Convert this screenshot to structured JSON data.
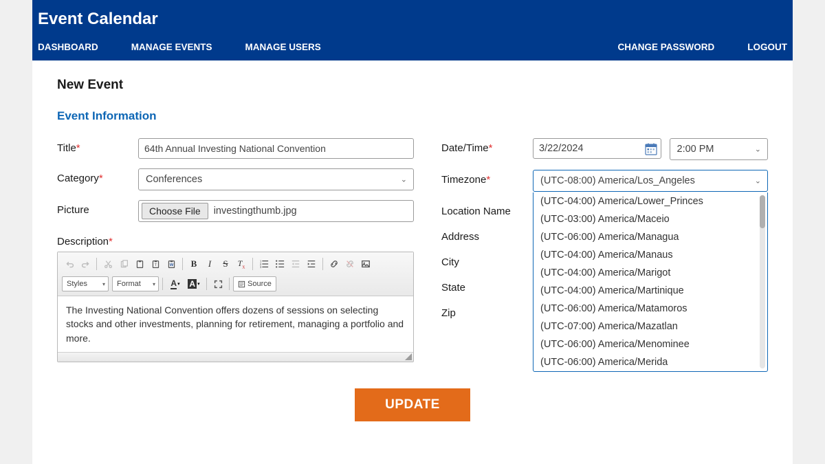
{
  "brand": "Event Calendar",
  "nav": {
    "left": [
      "DASHBOARD",
      "MANAGE EVENTS",
      "MANAGE USERS"
    ],
    "right": [
      "CHANGE PASSWORD",
      "LOGOUT"
    ]
  },
  "page_title": "New Event",
  "section_title": "Event Information",
  "labels": {
    "title": "Title",
    "category": "Category",
    "picture": "Picture",
    "description": "Description",
    "date_time": "Date/Time",
    "timezone": "Timezone",
    "location_name": "Location Name",
    "address": "Address",
    "city": "City",
    "state": "State",
    "zip": "Zip"
  },
  "values": {
    "title": "64th Annual Investing National Convention",
    "category": "Conferences",
    "file_btn": "Choose File",
    "file_name": "investingthumb.jpg",
    "date": "3/22/2024",
    "time": "2:00 PM",
    "timezone_selected": "(UTC-08:00) America/Los_Angeles",
    "description": "The Investing National Convention offers dozens of sessions on selecting stocks and other investments, planning for retirement, managing a portfolio and more."
  },
  "timezone_options": [
    "(UTC-04:00) America/Lower_Princes",
    "(UTC-03:00) America/Maceio",
    "(UTC-06:00) America/Managua",
    "(UTC-04:00) America/Manaus",
    "(UTC-04:00) America/Marigot",
    "(UTC-04:00) America/Martinique",
    "(UTC-06:00) America/Matamoros",
    "(UTC-07:00) America/Mazatlan",
    "(UTC-06:00) America/Menominee",
    "(UTC-06:00) America/Merida"
  ],
  "editor_toolbar": {
    "styles": "Styles",
    "format": "Format",
    "source": "Source"
  },
  "update_btn": "UPDATE",
  "colors": {
    "header_bg": "#003a8c",
    "accent": "#0d66b5",
    "update_bg": "#e36b1a"
  }
}
